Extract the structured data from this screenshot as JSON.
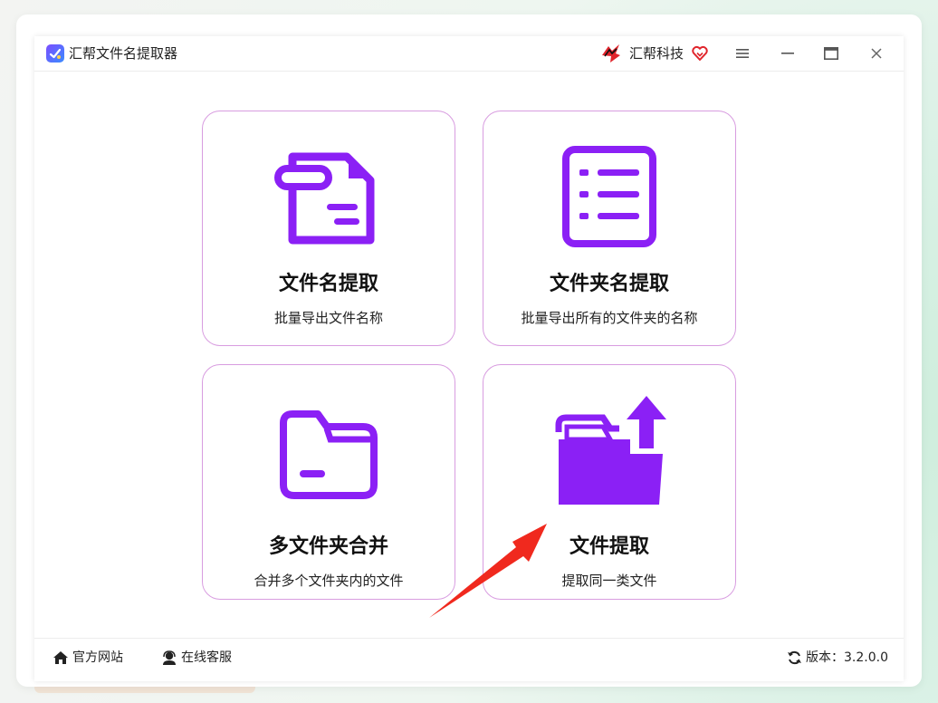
{
  "window": {
    "title": "汇帮文件名提取器",
    "brand": "汇帮科技"
  },
  "cards": [
    {
      "title": "文件名提取",
      "desc": "批量导出文件名称",
      "icon": "file-document-icon"
    },
    {
      "title": "文件夹名提取",
      "desc": "批量导出所有的文件夹的名称",
      "icon": "list-icon"
    },
    {
      "title": "多文件夹合并",
      "desc": "合并多个文件夹内的文件",
      "icon": "folder-icon"
    },
    {
      "title": "文件提取",
      "desc": "提取同一类文件",
      "icon": "folder-export-icon"
    }
  ],
  "footer": {
    "website": "官方网站",
    "service": "在线客服",
    "version": "版本：3.2.0.0"
  },
  "colors": {
    "accent": "#8b20f5",
    "card_border": "#d89ce0",
    "arrow": "#f0291e"
  }
}
